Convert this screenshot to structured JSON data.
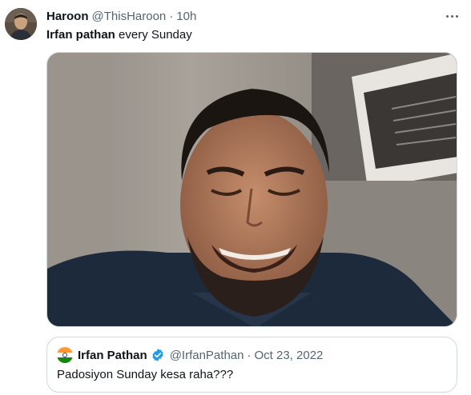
{
  "tweet": {
    "author_name": "Haroon",
    "handle": "@ThisHaroon",
    "separator": "·",
    "time": "10h",
    "text_bold": "Irfan pathan",
    "text_rest": " every Sunday"
  },
  "quote": {
    "author_name": "Irfan Pathan",
    "handle": "@IrfanPathan",
    "separator": "·",
    "date": "Oct 23, 2022",
    "text": "Padosiyon Sunday kesa raha???"
  },
  "icons": {
    "more": "more-horizontal-icon",
    "verified": "verified-badge-icon"
  },
  "colors": {
    "verified_blue": "#1d9bf0",
    "secondary_text": "#536471",
    "border": "#cfd9de"
  }
}
